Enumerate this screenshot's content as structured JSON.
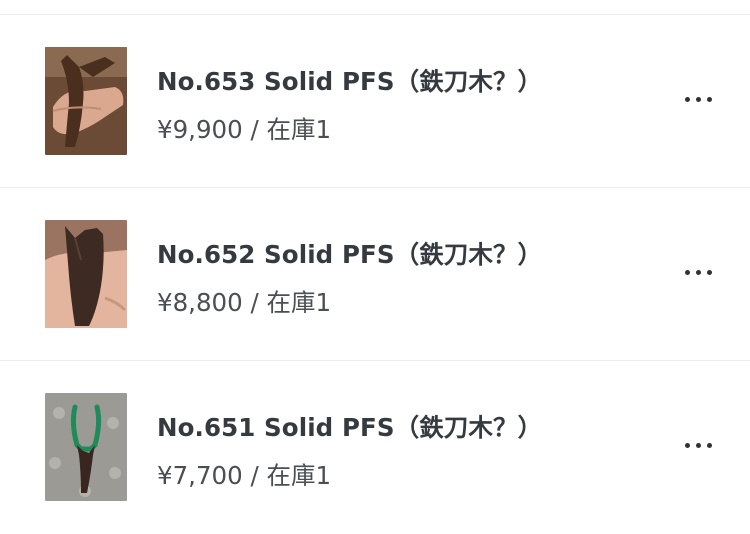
{
  "items": [
    {
      "title": "No.653 Solid PFS（鉄刀木？）",
      "price_line": "¥9,900 / 在庫1",
      "thumb_colors": {
        "bg": "#6b4a36",
        "wood": "#4a2e1e",
        "hand": "#d9a88e"
      },
      "more_icon": "more-horizontal-icon"
    },
    {
      "title": "No.652 Solid PFS（鉄刀木？）",
      "price_line": "¥8,800 / 在庫1",
      "thumb_colors": {
        "bg": "#9a7460",
        "wood": "#3d2a22",
        "hand": "#e3b49e"
      },
      "more_icon": "more-horizontal-icon"
    },
    {
      "title": "No.651 Solid PFS（鉄刀木？）",
      "price_line": "¥7,700 / 在庫1",
      "thumb_colors": {
        "bg": "#9c9a94",
        "wood": "#3a2620",
        "band": "#1f8a5a"
      },
      "more_icon": "more-horizontal-icon"
    }
  ]
}
